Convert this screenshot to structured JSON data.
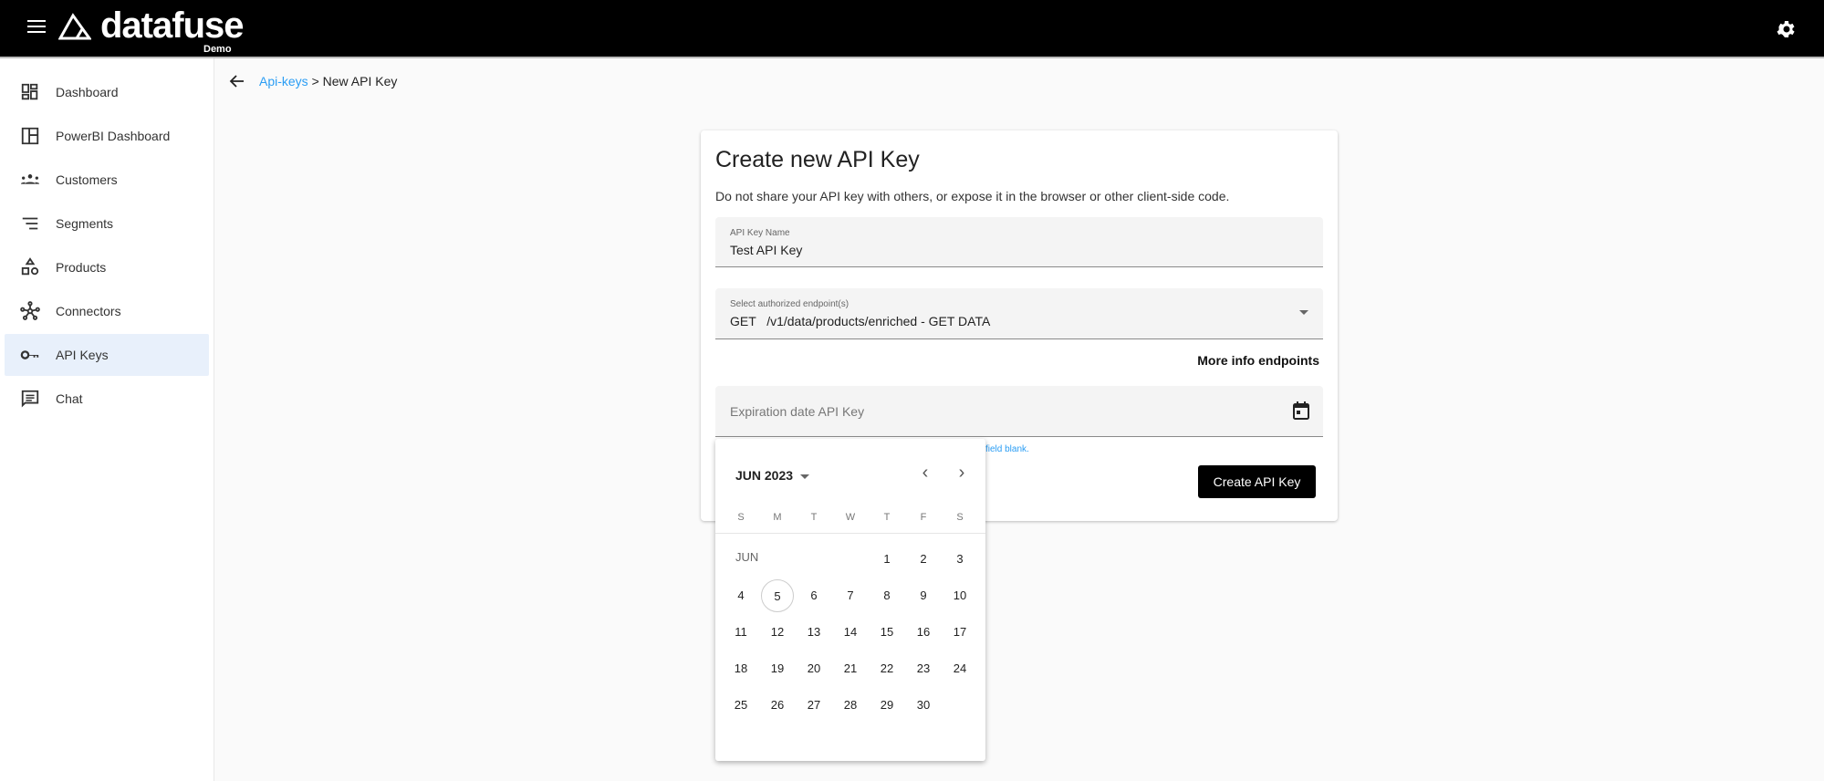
{
  "app": {
    "brand": "datafuse",
    "edition": "Demo"
  },
  "sidebar": {
    "items": [
      {
        "label": "Dashboard",
        "icon": "dashboard-icon"
      },
      {
        "label": "PowerBI Dashboard",
        "icon": "layout-icon"
      },
      {
        "label": "Customers",
        "icon": "groups-icon"
      },
      {
        "label": "Segments",
        "icon": "sort-lines-icon"
      },
      {
        "label": "Products",
        "icon": "shapes-icon"
      },
      {
        "label": "Connectors",
        "icon": "hub-icon"
      },
      {
        "label": "API Keys",
        "icon": "key-icon",
        "active": true
      },
      {
        "label": "Chat",
        "icon": "chat-icon"
      }
    ]
  },
  "breadcrumb": {
    "parent": "Api-keys",
    "separator": " > ",
    "current": "New API Key"
  },
  "form": {
    "title": "Create new API Key",
    "description": "Do not share your API key with others, or expose it in the browser or other client-side code.",
    "name_label": "API Key Name",
    "name_value": "Test API Key",
    "endpoint_label": "Select authorized endpoint(s)",
    "endpoint_value": "GET   /v1/data/products/enriched - GET DATA",
    "more_info": "More info endpoints",
    "expiration_placeholder": "Expiration date API Key",
    "helper_visible": "field blank.",
    "submit": "Create API Key"
  },
  "calendar": {
    "month_year": "JUN 2023",
    "month_short": "JUN",
    "weekdays": [
      "S",
      "M",
      "T",
      "W",
      "T",
      "F",
      "S"
    ],
    "first_weekday": 4,
    "days_in_month": 30,
    "today": 5
  },
  "colors": {
    "accent": "#2a9df4",
    "topbar": "#000000",
    "active_bg": "#e8f0fb"
  }
}
